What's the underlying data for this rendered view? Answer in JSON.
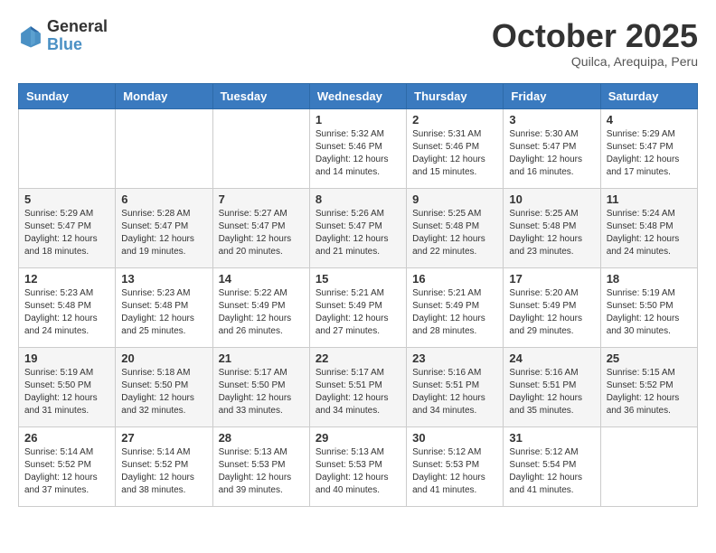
{
  "header": {
    "logo_line1": "General",
    "logo_line2": "Blue",
    "month": "October 2025",
    "location": "Quilca, Arequipa, Peru"
  },
  "weekdays": [
    "Sunday",
    "Monday",
    "Tuesday",
    "Wednesday",
    "Thursday",
    "Friday",
    "Saturday"
  ],
  "weeks": [
    [
      {
        "day": "",
        "info": ""
      },
      {
        "day": "",
        "info": ""
      },
      {
        "day": "",
        "info": ""
      },
      {
        "day": "1",
        "info": "Sunrise: 5:32 AM\nSunset: 5:46 PM\nDaylight: 12 hours and 14 minutes."
      },
      {
        "day": "2",
        "info": "Sunrise: 5:31 AM\nSunset: 5:46 PM\nDaylight: 12 hours and 15 minutes."
      },
      {
        "day": "3",
        "info": "Sunrise: 5:30 AM\nSunset: 5:47 PM\nDaylight: 12 hours and 16 minutes."
      },
      {
        "day": "4",
        "info": "Sunrise: 5:29 AM\nSunset: 5:47 PM\nDaylight: 12 hours and 17 minutes."
      }
    ],
    [
      {
        "day": "5",
        "info": "Sunrise: 5:29 AM\nSunset: 5:47 PM\nDaylight: 12 hours and 18 minutes."
      },
      {
        "day": "6",
        "info": "Sunrise: 5:28 AM\nSunset: 5:47 PM\nDaylight: 12 hours and 19 minutes."
      },
      {
        "day": "7",
        "info": "Sunrise: 5:27 AM\nSunset: 5:47 PM\nDaylight: 12 hours and 20 minutes."
      },
      {
        "day": "8",
        "info": "Sunrise: 5:26 AM\nSunset: 5:47 PM\nDaylight: 12 hours and 21 minutes."
      },
      {
        "day": "9",
        "info": "Sunrise: 5:25 AM\nSunset: 5:48 PM\nDaylight: 12 hours and 22 minutes."
      },
      {
        "day": "10",
        "info": "Sunrise: 5:25 AM\nSunset: 5:48 PM\nDaylight: 12 hours and 23 minutes."
      },
      {
        "day": "11",
        "info": "Sunrise: 5:24 AM\nSunset: 5:48 PM\nDaylight: 12 hours and 24 minutes."
      }
    ],
    [
      {
        "day": "12",
        "info": "Sunrise: 5:23 AM\nSunset: 5:48 PM\nDaylight: 12 hours and 24 minutes."
      },
      {
        "day": "13",
        "info": "Sunrise: 5:23 AM\nSunset: 5:48 PM\nDaylight: 12 hours and 25 minutes."
      },
      {
        "day": "14",
        "info": "Sunrise: 5:22 AM\nSunset: 5:49 PM\nDaylight: 12 hours and 26 minutes."
      },
      {
        "day": "15",
        "info": "Sunrise: 5:21 AM\nSunset: 5:49 PM\nDaylight: 12 hours and 27 minutes."
      },
      {
        "day": "16",
        "info": "Sunrise: 5:21 AM\nSunset: 5:49 PM\nDaylight: 12 hours and 28 minutes."
      },
      {
        "day": "17",
        "info": "Sunrise: 5:20 AM\nSunset: 5:49 PM\nDaylight: 12 hours and 29 minutes."
      },
      {
        "day": "18",
        "info": "Sunrise: 5:19 AM\nSunset: 5:50 PM\nDaylight: 12 hours and 30 minutes."
      }
    ],
    [
      {
        "day": "19",
        "info": "Sunrise: 5:19 AM\nSunset: 5:50 PM\nDaylight: 12 hours and 31 minutes."
      },
      {
        "day": "20",
        "info": "Sunrise: 5:18 AM\nSunset: 5:50 PM\nDaylight: 12 hours and 32 minutes."
      },
      {
        "day": "21",
        "info": "Sunrise: 5:17 AM\nSunset: 5:50 PM\nDaylight: 12 hours and 33 minutes."
      },
      {
        "day": "22",
        "info": "Sunrise: 5:17 AM\nSunset: 5:51 PM\nDaylight: 12 hours and 34 minutes."
      },
      {
        "day": "23",
        "info": "Sunrise: 5:16 AM\nSunset: 5:51 PM\nDaylight: 12 hours and 34 minutes."
      },
      {
        "day": "24",
        "info": "Sunrise: 5:16 AM\nSunset: 5:51 PM\nDaylight: 12 hours and 35 minutes."
      },
      {
        "day": "25",
        "info": "Sunrise: 5:15 AM\nSunset: 5:52 PM\nDaylight: 12 hours and 36 minutes."
      }
    ],
    [
      {
        "day": "26",
        "info": "Sunrise: 5:14 AM\nSunset: 5:52 PM\nDaylight: 12 hours and 37 minutes."
      },
      {
        "day": "27",
        "info": "Sunrise: 5:14 AM\nSunset: 5:52 PM\nDaylight: 12 hours and 38 minutes."
      },
      {
        "day": "28",
        "info": "Sunrise: 5:13 AM\nSunset: 5:53 PM\nDaylight: 12 hours and 39 minutes."
      },
      {
        "day": "29",
        "info": "Sunrise: 5:13 AM\nSunset: 5:53 PM\nDaylight: 12 hours and 40 minutes."
      },
      {
        "day": "30",
        "info": "Sunrise: 5:12 AM\nSunset: 5:53 PM\nDaylight: 12 hours and 41 minutes."
      },
      {
        "day": "31",
        "info": "Sunrise: 5:12 AM\nSunset: 5:54 PM\nDaylight: 12 hours and 41 minutes."
      },
      {
        "day": "",
        "info": ""
      }
    ]
  ]
}
